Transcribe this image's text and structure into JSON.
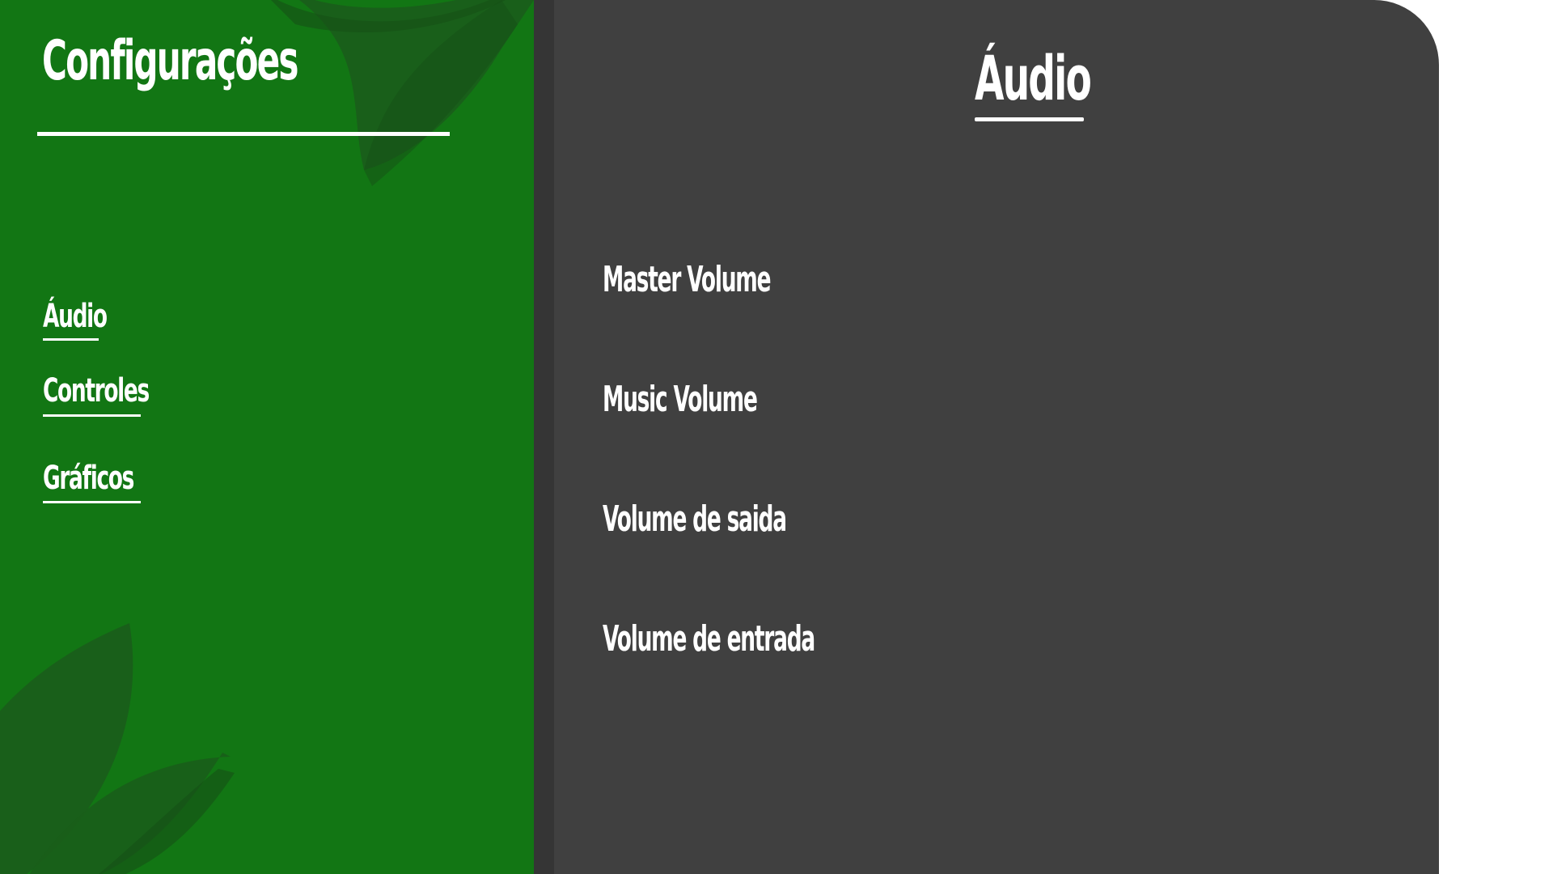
{
  "colors": {
    "sidebar_bg": "#127614",
    "leaf": "#1A5E1A",
    "panel_bg": "#404040",
    "text": "#FFFFFF",
    "page_bg": "#FFFFFF"
  },
  "sidebar": {
    "title": "Configurações",
    "items": [
      {
        "label": "Áudio",
        "active": true
      },
      {
        "label": "Controles",
        "active": false
      },
      {
        "label": "Gráficos",
        "active": false
      }
    ]
  },
  "panel": {
    "title": "Áudio",
    "settings": [
      {
        "label": "Master Volume"
      },
      {
        "label": "Music Volume"
      },
      {
        "label": "Volume de saida"
      },
      {
        "label": "Volume de entrada"
      }
    ]
  }
}
